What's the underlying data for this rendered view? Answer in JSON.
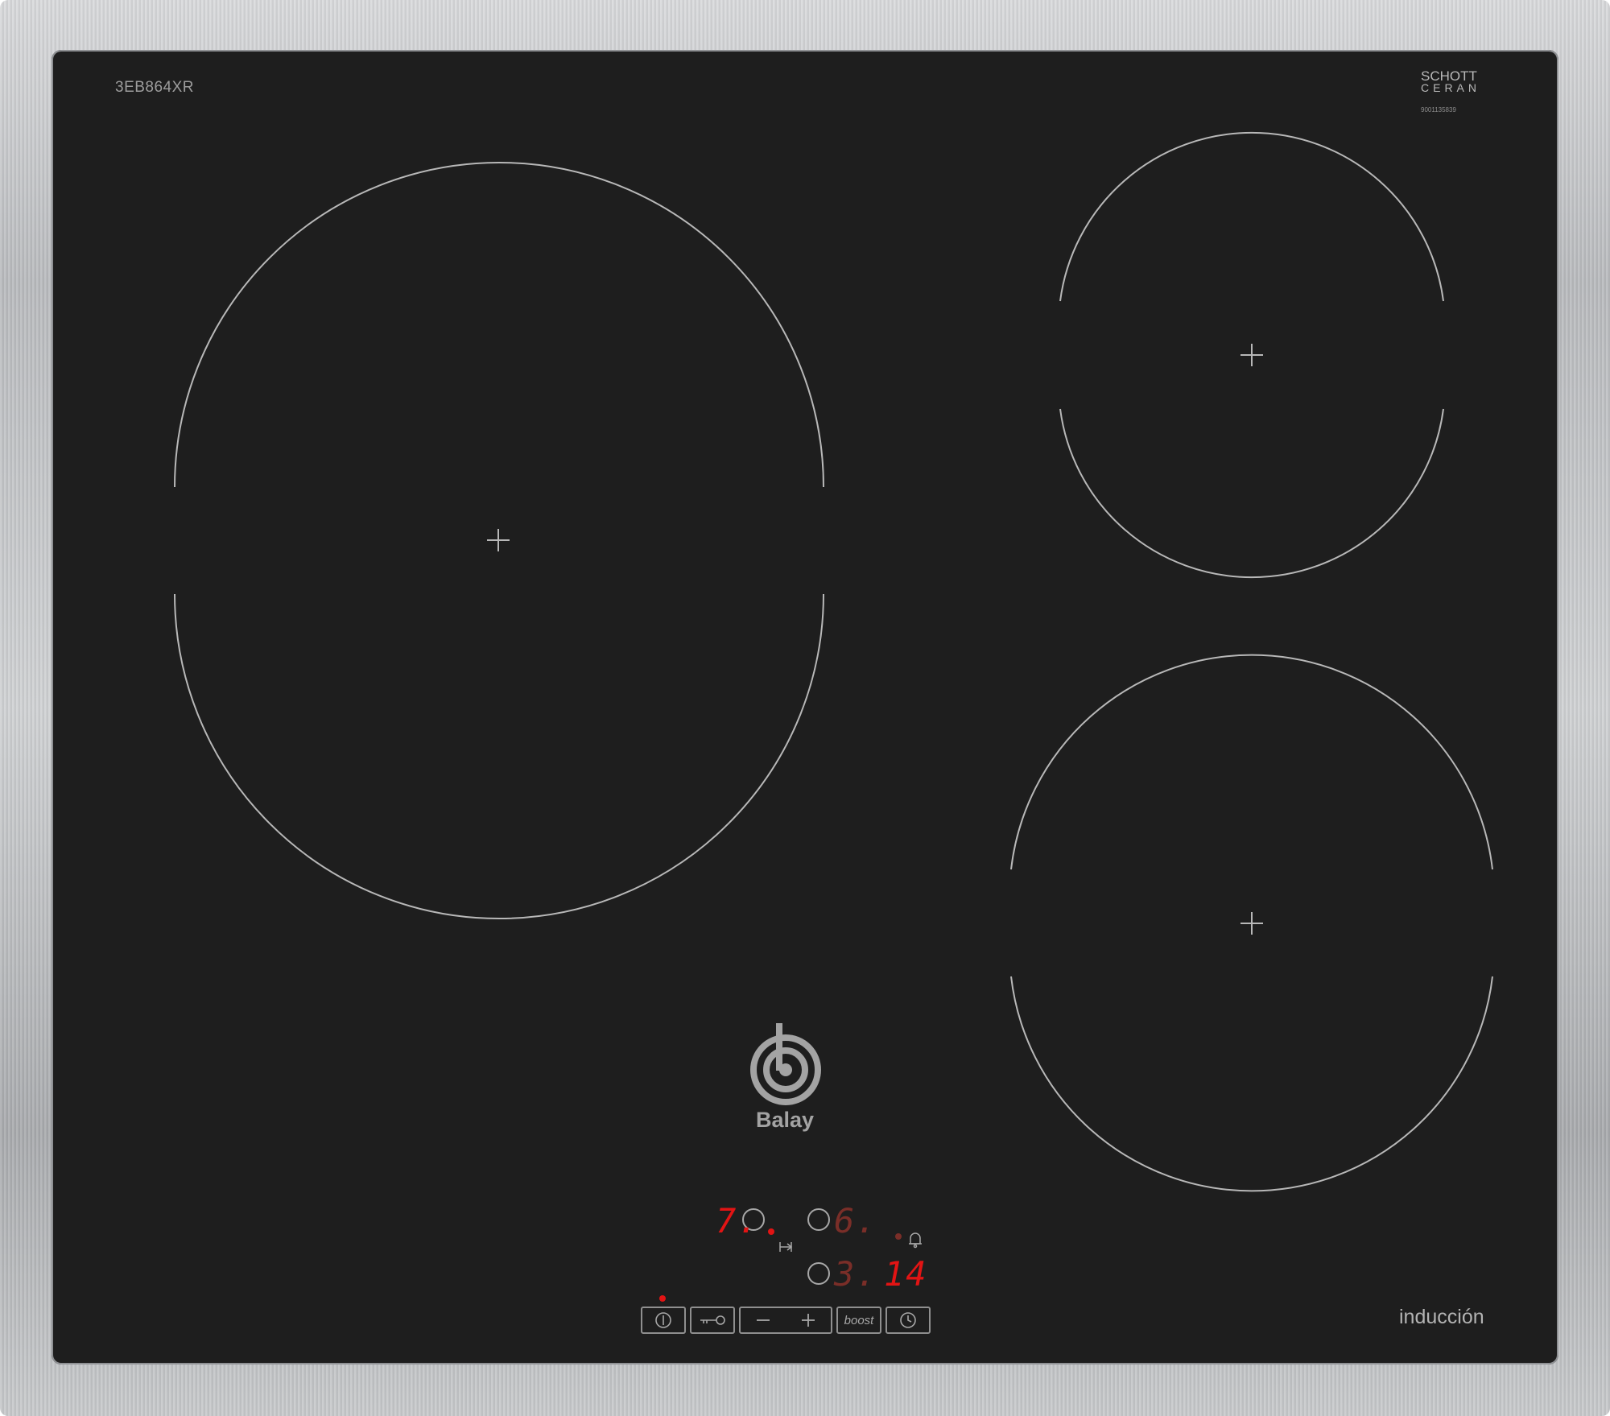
{
  "appliance": {
    "model": "3EB864XR",
    "glass_brand_line1": "SCHOTT",
    "glass_brand_line2": "CERAN",
    "serial": "9001135839",
    "brand": "Balay",
    "type_label": "inducción"
  },
  "display": {
    "zone_front_left_level": "7.",
    "zone_rear_right_level": "6.",
    "zone_front_right_level": "3.",
    "timer_value": "14"
  },
  "controls": {
    "power_icon": "power-icon",
    "lock_icon": "key-lock-icon",
    "minus_icon": "minus-icon",
    "plus_icon": "plus-icon",
    "boost_label": "boost",
    "timer_icon": "clock-icon",
    "alarm_icon": "bell-icon",
    "transfer_icon": "transfer-icon"
  },
  "colors": {
    "glass": "#1e1e1e",
    "frame": "#c3c5c8",
    "zone_marking": "#b8b8b8",
    "display_active": "#e21414",
    "display_dim": "#7a2e28"
  }
}
